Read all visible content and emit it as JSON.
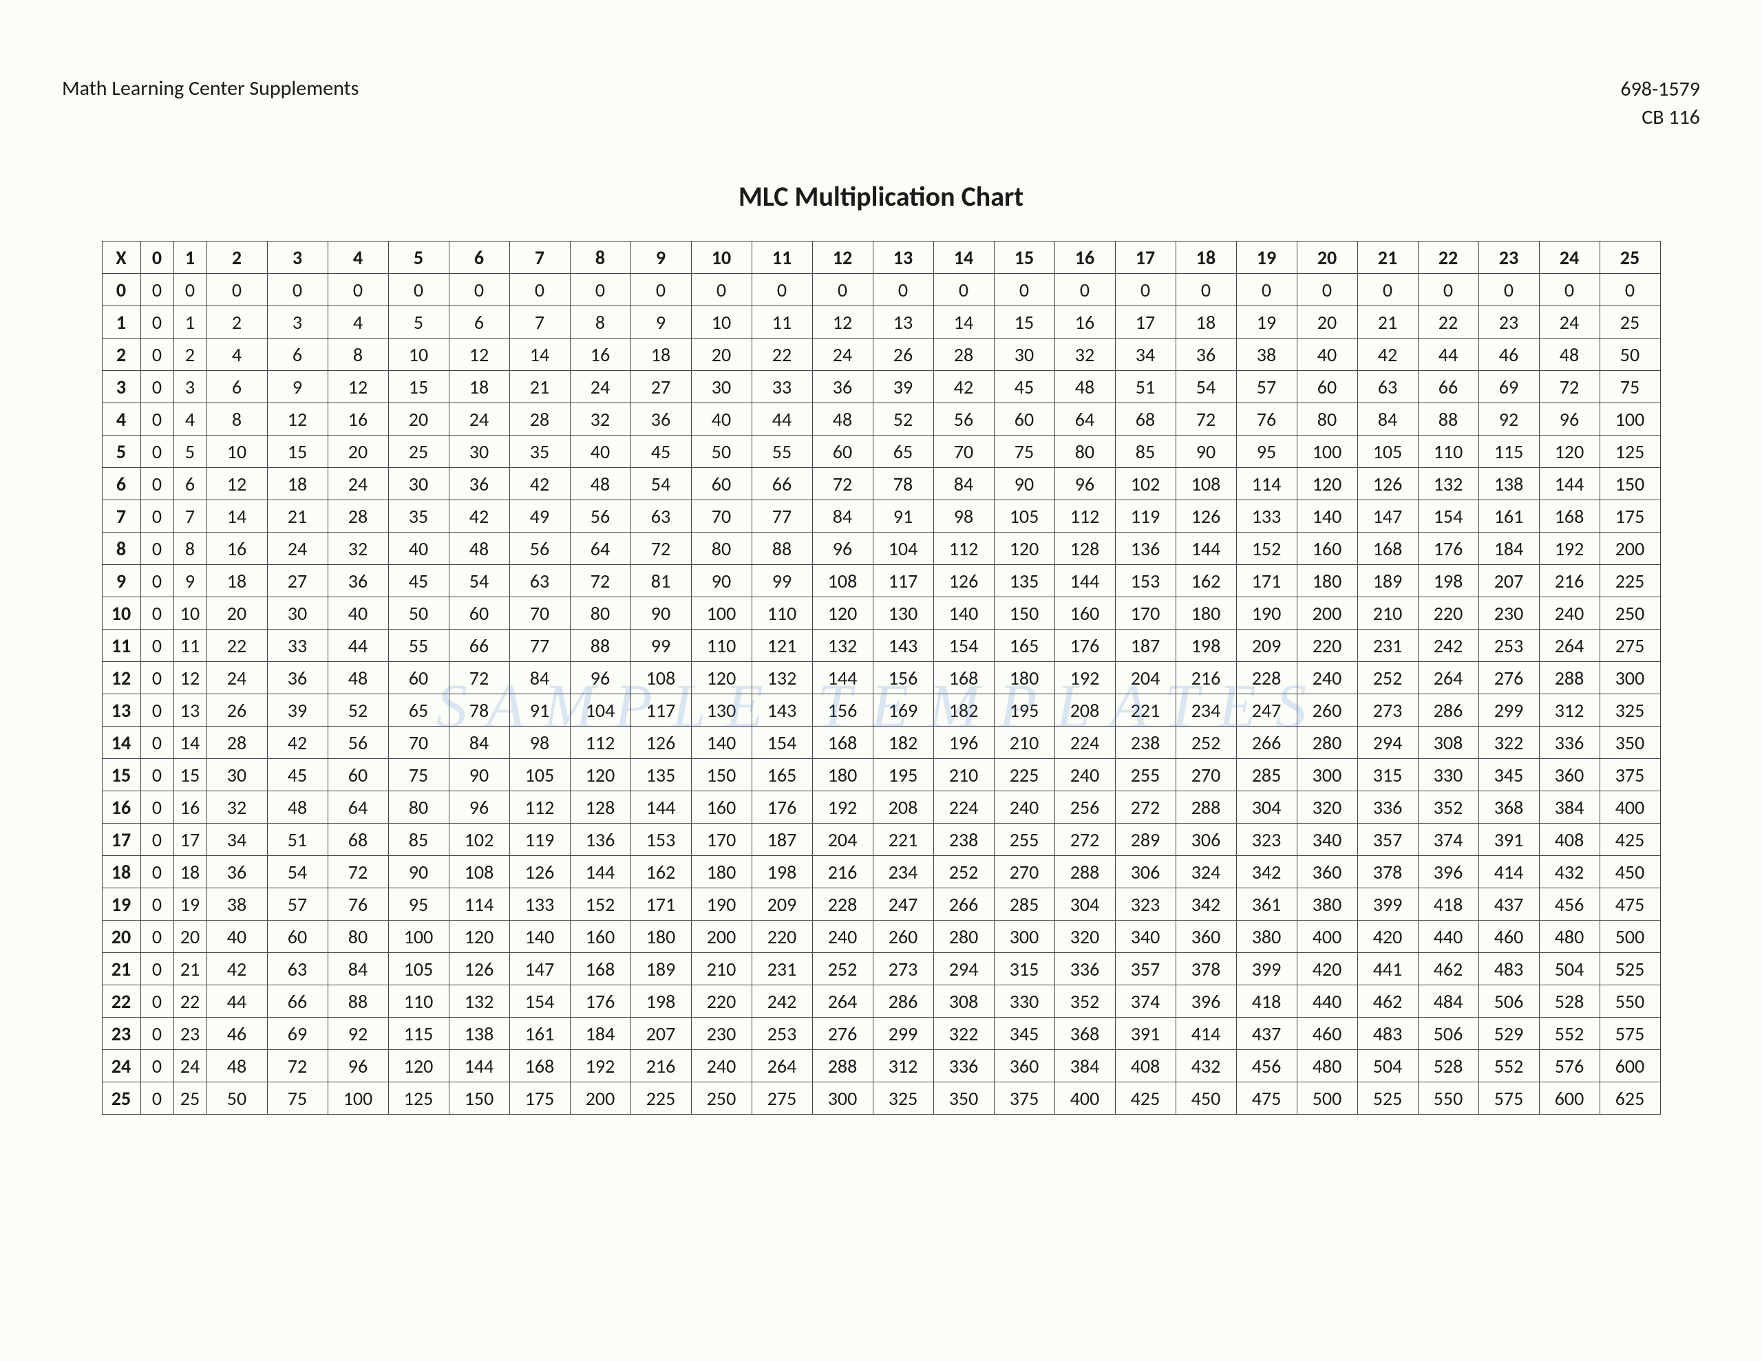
{
  "header": {
    "left": "Math Learning Center Supplements",
    "right_line1": "698-1579",
    "right_line2": "CB 116"
  },
  "title": "MLC Multiplication Chart",
  "corner_label": "X",
  "max": 25,
  "watermark": "SAMPLE TEMPLATES",
  "chart_data": {
    "type": "table",
    "title": "MLC Multiplication Chart",
    "row_headers": [
      0,
      1,
      2,
      3,
      4,
      5,
      6,
      7,
      8,
      9,
      10,
      11,
      12,
      13,
      14,
      15,
      16,
      17,
      18,
      19,
      20,
      21,
      22,
      23,
      24,
      25
    ],
    "col_headers": [
      0,
      1,
      2,
      3,
      4,
      5,
      6,
      7,
      8,
      9,
      10,
      11,
      12,
      13,
      14,
      15,
      16,
      17,
      18,
      19,
      20,
      21,
      22,
      23,
      24,
      25
    ],
    "values": [
      [
        0,
        0,
        0,
        0,
        0,
        0,
        0,
        0,
        0,
        0,
        0,
        0,
        0,
        0,
        0,
        0,
        0,
        0,
        0,
        0,
        0,
        0,
        0,
        0,
        0,
        0
      ],
      [
        0,
        1,
        2,
        3,
        4,
        5,
        6,
        7,
        8,
        9,
        10,
        11,
        12,
        13,
        14,
        15,
        16,
        17,
        18,
        19,
        20,
        21,
        22,
        23,
        24,
        25
      ],
      [
        0,
        2,
        4,
        6,
        8,
        10,
        12,
        14,
        16,
        18,
        20,
        22,
        24,
        26,
        28,
        30,
        32,
        34,
        36,
        38,
        40,
        42,
        44,
        46,
        48,
        50
      ],
      [
        0,
        3,
        6,
        9,
        12,
        15,
        18,
        21,
        24,
        27,
        30,
        33,
        36,
        39,
        42,
        45,
        48,
        51,
        54,
        57,
        60,
        63,
        66,
        69,
        72,
        75
      ],
      [
        0,
        4,
        8,
        12,
        16,
        20,
        24,
        28,
        32,
        36,
        40,
        44,
        48,
        52,
        56,
        60,
        64,
        68,
        72,
        76,
        80,
        84,
        88,
        92,
        96,
        100
      ],
      [
        0,
        5,
        10,
        15,
        20,
        25,
        30,
        35,
        40,
        45,
        50,
        55,
        60,
        65,
        70,
        75,
        80,
        85,
        90,
        95,
        100,
        105,
        110,
        115,
        120,
        125
      ],
      [
        0,
        6,
        12,
        18,
        24,
        30,
        36,
        42,
        48,
        54,
        60,
        66,
        72,
        78,
        84,
        90,
        96,
        102,
        108,
        114,
        120,
        126,
        132,
        138,
        144,
        150
      ],
      [
        0,
        7,
        14,
        21,
        28,
        35,
        42,
        49,
        56,
        63,
        70,
        77,
        84,
        91,
        98,
        105,
        112,
        119,
        126,
        133,
        140,
        147,
        154,
        161,
        168,
        175
      ],
      [
        0,
        8,
        16,
        24,
        32,
        40,
        48,
        56,
        64,
        72,
        80,
        88,
        96,
        104,
        112,
        120,
        128,
        136,
        144,
        152,
        160,
        168,
        176,
        184,
        192,
        200
      ],
      [
        0,
        9,
        18,
        27,
        36,
        45,
        54,
        63,
        72,
        81,
        90,
        99,
        108,
        117,
        126,
        135,
        144,
        153,
        162,
        171,
        180,
        189,
        198,
        207,
        216,
        225
      ],
      [
        0,
        10,
        20,
        30,
        40,
        50,
        60,
        70,
        80,
        90,
        100,
        110,
        120,
        130,
        140,
        150,
        160,
        170,
        180,
        190,
        200,
        210,
        220,
        230,
        240,
        250
      ],
      [
        0,
        11,
        22,
        33,
        44,
        55,
        66,
        77,
        88,
        99,
        110,
        121,
        132,
        143,
        154,
        165,
        176,
        187,
        198,
        209,
        220,
        231,
        242,
        253,
        264,
        275
      ],
      [
        0,
        12,
        24,
        36,
        48,
        60,
        72,
        84,
        96,
        108,
        120,
        132,
        144,
        156,
        168,
        180,
        192,
        204,
        216,
        228,
        240,
        252,
        264,
        276,
        288,
        300
      ],
      [
        0,
        13,
        26,
        39,
        52,
        65,
        78,
        91,
        104,
        117,
        130,
        143,
        156,
        169,
        182,
        195,
        208,
        221,
        234,
        247,
        260,
        273,
        286,
        299,
        312,
        325
      ],
      [
        0,
        14,
        28,
        42,
        56,
        70,
        84,
        98,
        112,
        126,
        140,
        154,
        168,
        182,
        196,
        210,
        224,
        238,
        252,
        266,
        280,
        294,
        308,
        322,
        336,
        350
      ],
      [
        0,
        15,
        30,
        45,
        60,
        75,
        90,
        105,
        120,
        135,
        150,
        165,
        180,
        195,
        210,
        225,
        240,
        255,
        270,
        285,
        300,
        315,
        330,
        345,
        360,
        375
      ],
      [
        0,
        16,
        32,
        48,
        64,
        80,
        96,
        112,
        128,
        144,
        160,
        176,
        192,
        208,
        224,
        240,
        256,
        272,
        288,
        304,
        320,
        336,
        352,
        368,
        384,
        400
      ],
      [
        0,
        17,
        34,
        51,
        68,
        85,
        102,
        119,
        136,
        153,
        170,
        187,
        204,
        221,
        238,
        255,
        272,
        289,
        306,
        323,
        340,
        357,
        374,
        391,
        408,
        425
      ],
      [
        0,
        18,
        36,
        54,
        72,
        90,
        108,
        126,
        144,
        162,
        180,
        198,
        216,
        234,
        252,
        270,
        288,
        306,
        324,
        342,
        360,
        378,
        396,
        414,
        432,
        450
      ],
      [
        0,
        19,
        38,
        57,
        76,
        95,
        114,
        133,
        152,
        171,
        190,
        209,
        228,
        247,
        266,
        285,
        304,
        323,
        342,
        361,
        380,
        399,
        418,
        437,
        456,
        475
      ],
      [
        0,
        20,
        40,
        60,
        80,
        100,
        120,
        140,
        160,
        180,
        200,
        220,
        240,
        260,
        280,
        300,
        320,
        340,
        360,
        380,
        400,
        420,
        440,
        460,
        480,
        500
      ],
      [
        0,
        21,
        42,
        63,
        84,
        105,
        126,
        147,
        168,
        189,
        210,
        231,
        252,
        273,
        294,
        315,
        336,
        357,
        378,
        399,
        420,
        441,
        462,
        483,
        504,
        525
      ],
      [
        0,
        22,
        44,
        66,
        88,
        110,
        132,
        154,
        176,
        198,
        220,
        242,
        264,
        286,
        308,
        330,
        352,
        374,
        396,
        418,
        440,
        462,
        484,
        506,
        528,
        550
      ],
      [
        0,
        23,
        46,
        69,
        92,
        115,
        138,
        161,
        184,
        207,
        230,
        253,
        276,
        299,
        322,
        345,
        368,
        391,
        414,
        437,
        460,
        483,
        506,
        529,
        552,
        575
      ],
      [
        0,
        24,
        48,
        72,
        96,
        120,
        144,
        168,
        192,
        216,
        240,
        264,
        288,
        312,
        336,
        360,
        384,
        408,
        432,
        456,
        480,
        504,
        528,
        552,
        576,
        600
      ],
      [
        0,
        25,
        50,
        75,
        100,
        125,
        150,
        175,
        200,
        225,
        250,
        275,
        300,
        325,
        350,
        375,
        400,
        425,
        450,
        475,
        500,
        525,
        550,
        575,
        600,
        625
      ]
    ]
  }
}
